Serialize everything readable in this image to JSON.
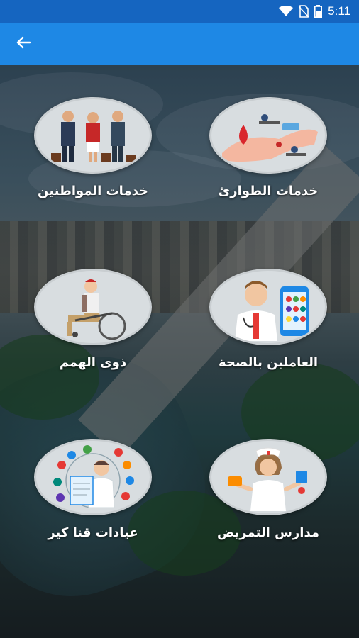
{
  "status_bar": {
    "time": "5:11",
    "icons": [
      "wifi-icon",
      "no-sim-icon",
      "battery-icon"
    ]
  },
  "app_bar": {
    "back_icon": "arrow-back-icon",
    "color": "#1e88e5",
    "status_color": "#1565c0"
  },
  "tiles": [
    {
      "label": "خدمات الطوارئ",
      "icon": "emergency-services-icon"
    },
    {
      "label": "خدمات المواطنين",
      "icon": "citizen-services-icon"
    },
    {
      "label": "العاملين بالصحة",
      "icon": "health-workers-icon"
    },
    {
      "label": "ذوى الهمم",
      "icon": "wheelchair-icon"
    },
    {
      "label": "مدارس التمريض",
      "icon": "nurse-icon"
    },
    {
      "label": "عيادات قنا كير",
      "icon": "clinic-icon"
    }
  ]
}
